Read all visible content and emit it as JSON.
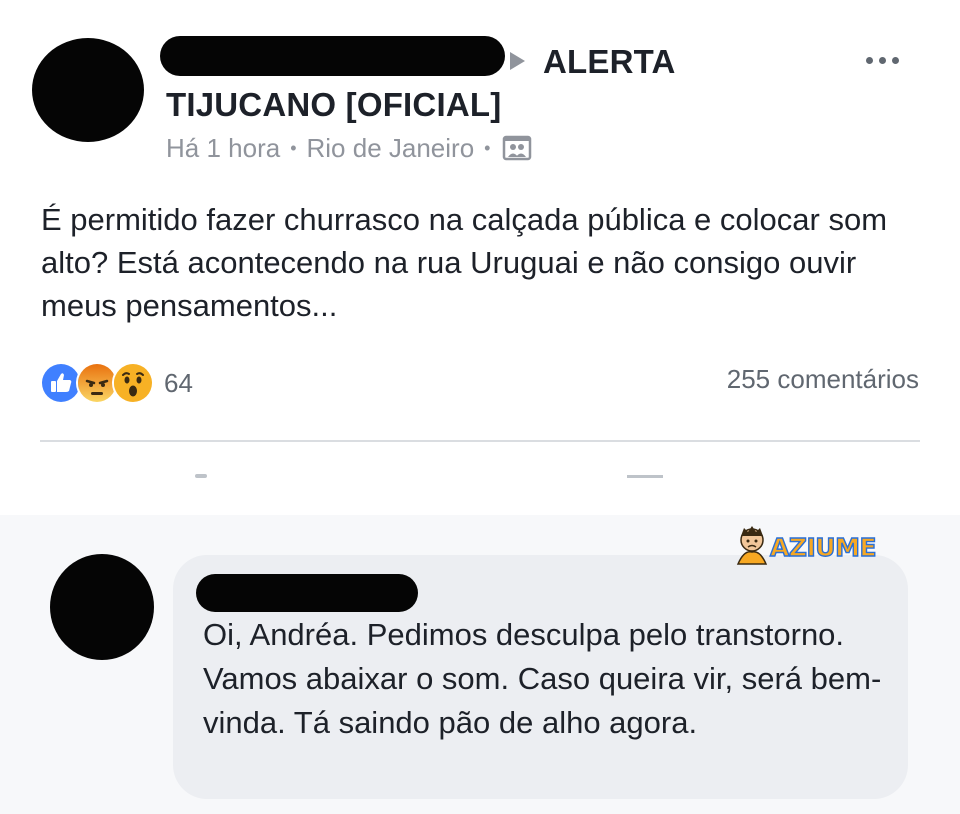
{
  "post": {
    "group_name": "ALERTA TIJUCANO [OFICIAL]",
    "timestamp": "Há 1 hora",
    "separator": "•",
    "location": "Rio de Janeiro",
    "audience_icon": "group-photo-icon",
    "more_icon": "more-options-icon",
    "text": "É permitido fazer churrasco na calçada pública e colocar som alto? Está acontecendo na rua Uruguai e não consigo ouvir meus pensamentos..."
  },
  "reactions": {
    "icons": [
      "like-reaction-icon",
      "angry-reaction-icon",
      "wow-reaction-icon"
    ],
    "count": "64",
    "comments": "255 comentários"
  },
  "comment": {
    "text": "Oi, Andréa. Pedimos desculpa pelo transtorno. Vamos abaixar o som. Caso queira vir, será bem-vinda. Tá saindo pão de alho agora."
  },
  "watermark": {
    "text": "AZIUME"
  },
  "colors": {
    "text": "#1d2129",
    "secondary": "#90949c",
    "like_blue": "#4080ff",
    "reaction_yellow": "#f7b125",
    "angry_orange": "#e9710f",
    "bubble": "#eceef2"
  }
}
